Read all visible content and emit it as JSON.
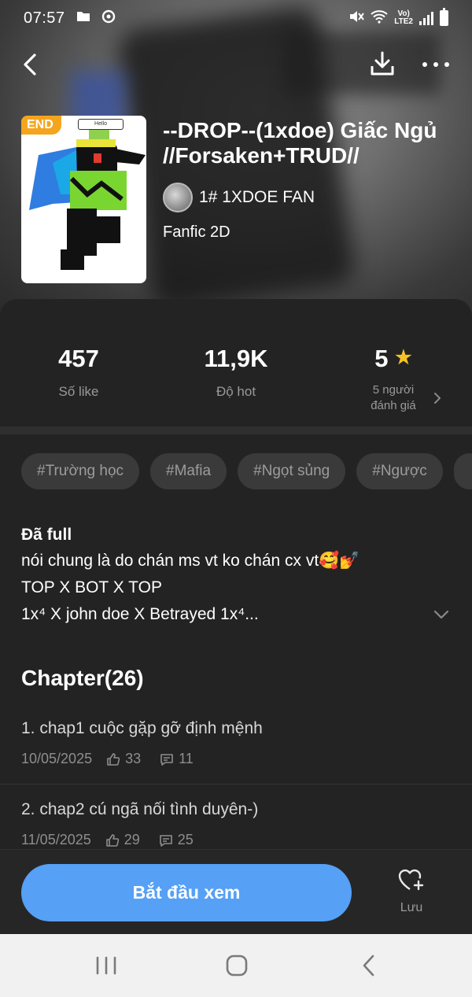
{
  "status_bar": {
    "time": "07:57",
    "network_top": "Vo)",
    "network_bottom": "LTE2"
  },
  "story": {
    "badge": "END",
    "cover_speech": "Hello",
    "title": "--DROP--(1xdoe) Giấc Ngủ //Forsaken+TRUD//",
    "author": "1# 1XDOE FAN",
    "genre": "Fanfic 2D"
  },
  "stats": {
    "likes": {
      "value": "457",
      "label": "Số like"
    },
    "hot": {
      "value": "11,9K",
      "label": "Độ hot"
    },
    "rating": {
      "value": "5",
      "label_line1": "5 người",
      "label_line2": "đánh giá"
    }
  },
  "tags": [
    "#Trường học",
    "#Mafia",
    "#Ngọt sủng",
    "#Ngược"
  ],
  "description": {
    "status": "Đã full",
    "lines": [
      "nói chung là do chán ms vt ko chán cx vt🥰💅",
      "TOP X BOT X TOP",
      "1x⁴ X john doe X Betrayed 1x⁴..."
    ]
  },
  "chapters": {
    "heading": "Chapter(26)",
    "items": [
      {
        "title": "1. chap1 cuộc gặp gỡ định mệnh",
        "date": "10/05/2025",
        "likes": "33",
        "comments": "11"
      },
      {
        "title": "2. chap2 cú ngã nối tình duyên-)",
        "date": "11/05/2025",
        "likes": "29",
        "comments": "25"
      }
    ]
  },
  "actions": {
    "start_label": "Bắt đầu xem",
    "save_label": "Lưu"
  },
  "colors": {
    "accent": "#56a0f5",
    "badge": "#f4a51e",
    "star": "#f6c326",
    "background": "#232323"
  }
}
